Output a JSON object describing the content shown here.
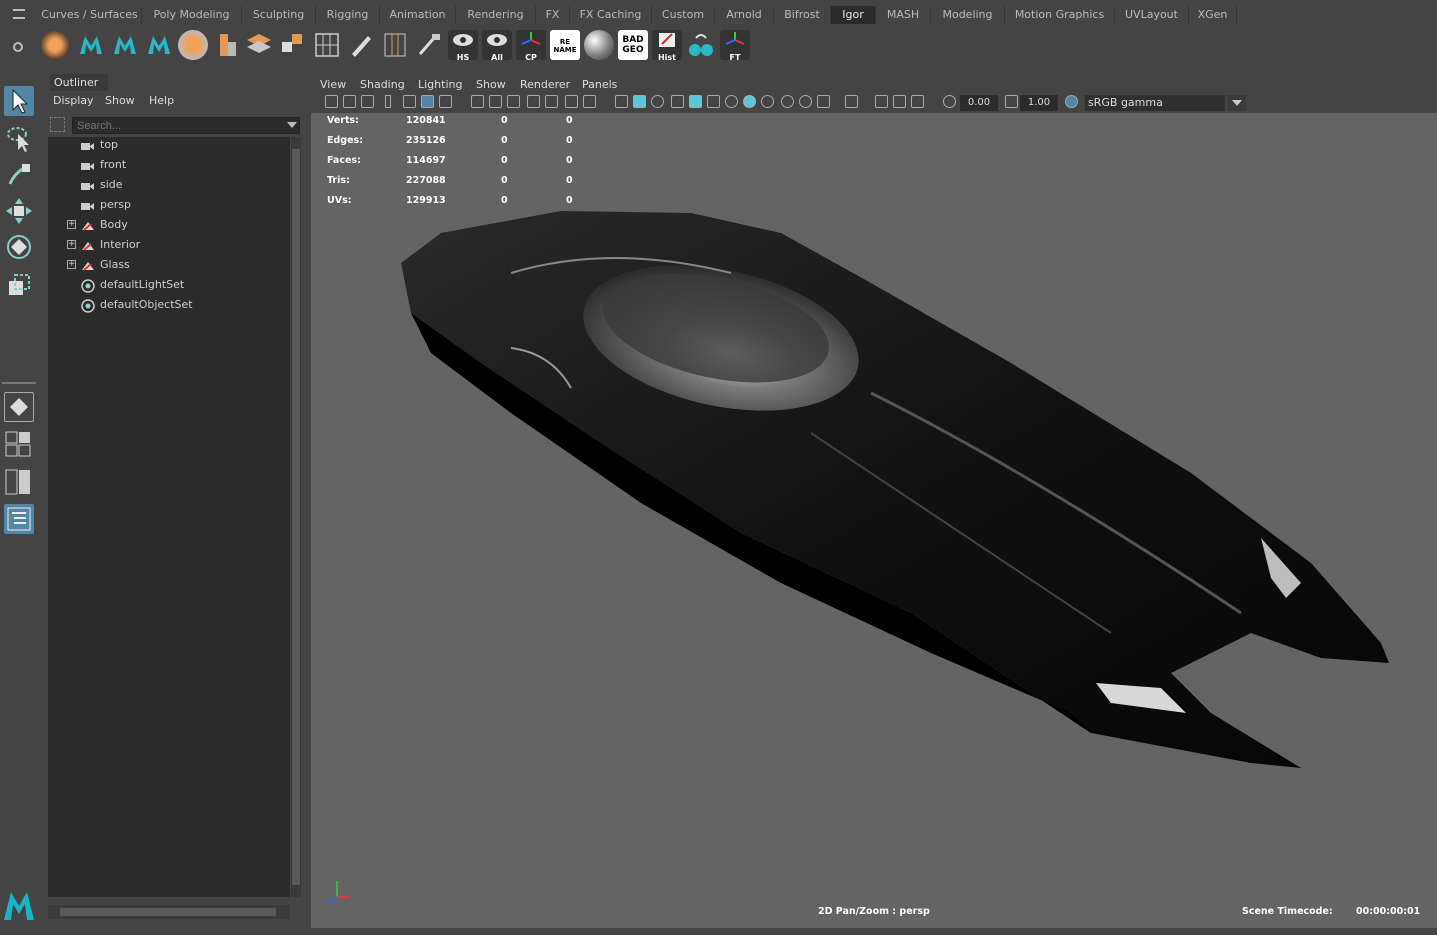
{
  "shelf_tabs": [
    "Curves / Surfaces",
    "Poly Modeling",
    "Sculpting",
    "Rigging",
    "Animation",
    "Rendering",
    "FX",
    "FX Caching",
    "Custom",
    "Arnold",
    "Bifrost",
    "Igor",
    "MASH",
    "Modeling",
    "Motion Graphics",
    "UVLayout",
    "XGen"
  ],
  "active_tab": "Igor",
  "shelf_labels": {
    "hs": "HS",
    "all": "All",
    "cp": "CP",
    "rename": "RE NAME",
    "badgeo": "BAD GEO",
    "hist": "Hist",
    "ft": "FT"
  },
  "outliner": {
    "tab": "Outliner",
    "menu": [
      "Display",
      "Show",
      "Help"
    ],
    "search_placeholder": "Search...",
    "items": [
      {
        "label": "top",
        "type": "camera"
      },
      {
        "label": "front",
        "type": "camera"
      },
      {
        "label": "side",
        "type": "camera"
      },
      {
        "label": "persp",
        "type": "camera"
      },
      {
        "label": "Body",
        "type": "group"
      },
      {
        "label": "Interior",
        "type": "group"
      },
      {
        "label": "Glass",
        "type": "group"
      },
      {
        "label": "defaultLightSet",
        "type": "set"
      },
      {
        "label": "defaultObjectSet",
        "type": "set"
      }
    ]
  },
  "viewport": {
    "menu": [
      "View",
      "Shading",
      "Lighting",
      "Show",
      "Renderer",
      "Panels"
    ],
    "exposure": "0.00",
    "gamma": "1.00",
    "color_space": "sRGB gamma",
    "stats": [
      {
        "label": "Verts:",
        "v1": "120841",
        "v2": "0",
        "v3": "0"
      },
      {
        "label": "Edges:",
        "v1": "235126",
        "v2": "0",
        "v3": "0"
      },
      {
        "label": "Faces:",
        "v1": "114697",
        "v2": "0",
        "v3": "0"
      },
      {
        "label": "Tris:",
        "v1": "227088",
        "v2": "0",
        "v3": "0"
      },
      {
        "label": "UVs:",
        "v1": "129913",
        "v2": "0",
        "v3": "0"
      }
    ],
    "camera_label": "2D Pan/Zoom : persp",
    "timecode_label": "Scene Timecode:",
    "timecode_value": "00:00:00:01"
  },
  "colors": {
    "accent": "#5285a6",
    "viewport_bg": "#646464",
    "panel_bg": "#444444",
    "field_bg": "#2b2b2b"
  }
}
